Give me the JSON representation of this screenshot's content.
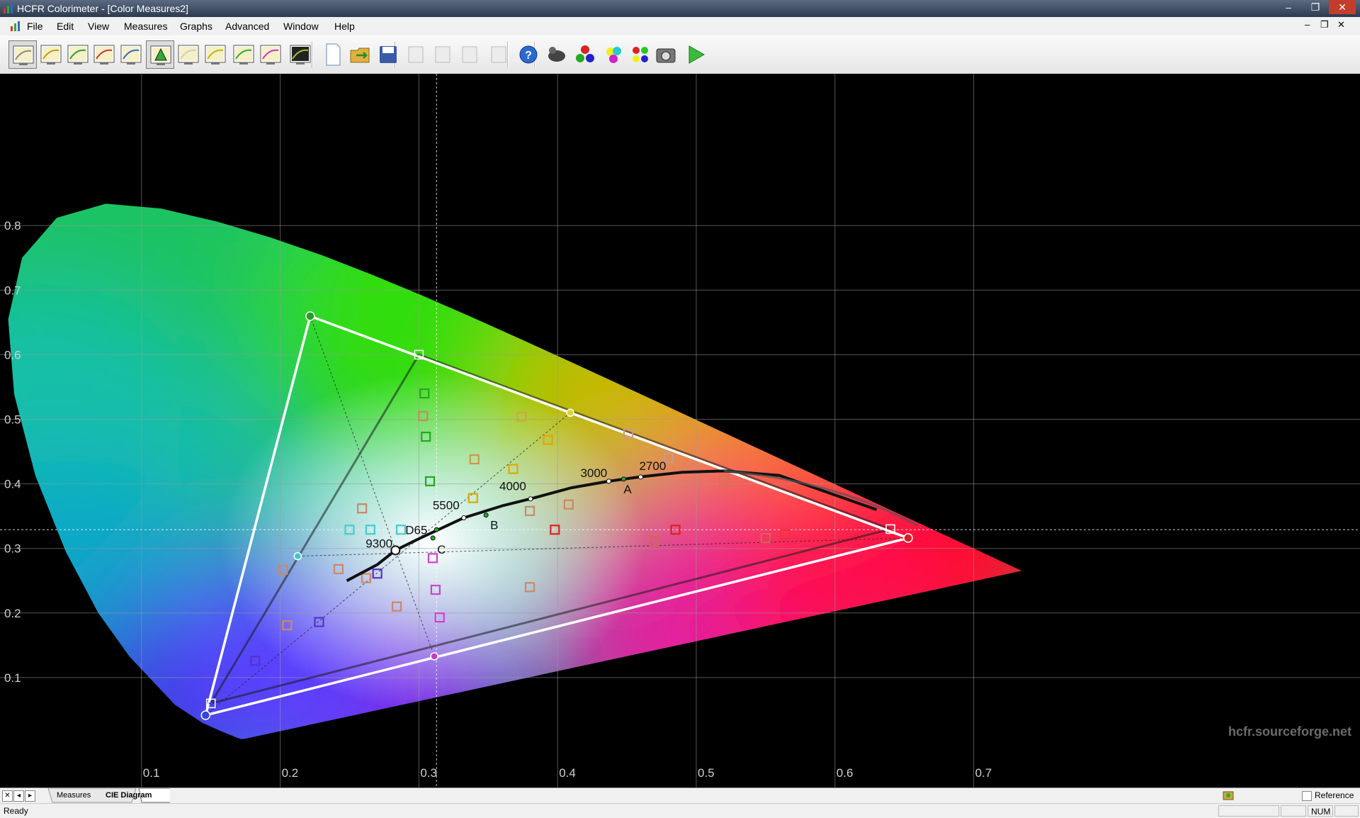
{
  "window": {
    "title": "HCFR Colorimeter - [Color Measures2]",
    "minimize": "–",
    "restore": "❐",
    "close": "✕"
  },
  "menu": [
    "File",
    "Edit",
    "View",
    "Measures",
    "Graphs",
    "Advanced",
    "Window",
    "Help"
  ],
  "mdi_controls": [
    "–",
    "❐",
    "✕"
  ],
  "toolbar": {
    "buttons": [
      "luminance-graph-icon",
      "gamma-graph-icon",
      "gamma-graph-icon-2",
      "rgb-levels-icon",
      "colortemp-graph-icon",
      "cie-diagram-icon",
      "near-black-icon",
      "near-white-icon",
      "saturation-luminance-icon",
      "saturation-shift-icon",
      "measures-icon",
      "new-document-icon",
      "open-folder-icon",
      "save-icon",
      "cut-icon",
      "copy-icon",
      "paste-icon",
      "print-icon",
      "help-icon",
      "sensor-icon",
      "primaries-icon",
      "secondaries-icon",
      "all-colors-icon",
      "camera-icon",
      "play-icon"
    ]
  },
  "chart_data": {
    "type": "scatter",
    "title": "",
    "xlabel": "",
    "ylabel": "",
    "xlim": [
      0.0,
      0.8
    ],
    "ylim": [
      0.0,
      0.9
    ],
    "x_ticks": [
      "0.1",
      "0.2",
      "0.3",
      "0.4",
      "0.5",
      "0.6",
      "0.7"
    ],
    "y_ticks": [
      "0.1",
      "0.2",
      "0.3",
      "0.4",
      "0.5",
      "0.6",
      "0.7",
      "0.8"
    ],
    "grid": true,
    "watermark": "hcfr.sourceforge.net",
    "reference_gamut": [
      [
        0.64,
        0.33
      ],
      [
        0.3,
        0.6
      ],
      [
        0.15,
        0.06
      ]
    ],
    "measured_gamut": [
      [
        0.6527,
        0.3161
      ],
      [
        0.2216,
        0.6597
      ],
      [
        0.1462,
        0.0417
      ]
    ],
    "measured_secondaries": [
      [
        0.4091,
        0.5101
      ],
      [
        0.2126,
        0.288
      ],
      [
        0.3111,
        0.1329
      ]
    ],
    "crosshair": {
      "x": 0.3127,
      "y": 0.329
    },
    "planckian_locus": [
      [
        0.248,
        0.25
      ],
      [
        0.27,
        0.275
      ],
      [
        0.2831,
        0.2971
      ],
      [
        0.3,
        0.315
      ],
      [
        0.3324,
        0.3474
      ],
      [
        0.36,
        0.366
      ],
      [
        0.3805,
        0.3768
      ],
      [
        0.41,
        0.394
      ],
      [
        0.4369,
        0.4041
      ],
      [
        0.46,
        0.411
      ],
      [
        0.49,
        0.418
      ],
      [
        0.52,
        0.42
      ],
      [
        0.56,
        0.413
      ],
      [
        0.63,
        0.36
      ]
    ],
    "locus_labels": [
      {
        "text": "9300",
        "x": 0.2831,
        "y": 0.2971
      },
      {
        "text": "5500",
        "x": 0.3324,
        "y": 0.3474
      },
      {
        "text": "4000",
        "x": 0.3805,
        "y": 0.3768
      },
      {
        "text": "3000",
        "x": 0.4369,
        "y": 0.4041
      },
      {
        "text": "2700",
        "x": 0.4599,
        "y": 0.4106
      }
    ],
    "illuminant_labels": [
      {
        "text": "D65",
        "x": 0.3127,
        "y": 0.329
      },
      {
        "text": "C",
        "x": 0.3101,
        "y": 0.3162
      },
      {
        "text": "B",
        "x": 0.3484,
        "y": 0.3516
      },
      {
        "text": "A",
        "x": 0.4476,
        "y": 0.4074
      }
    ],
    "saturation_points": [
      {
        "x": 0.304,
        "y": 0.54,
        "color": "#22aa22"
      },
      {
        "x": 0.303,
        "y": 0.505,
        "color": "#cc8866"
      },
      {
        "x": 0.305,
        "y": 0.473,
        "color": "#22aa22"
      },
      {
        "x": 0.308,
        "y": 0.404,
        "color": "#22aa22"
      },
      {
        "x": 0.374,
        "y": 0.504,
        "color": "#ccaa44"
      },
      {
        "x": 0.393,
        "y": 0.468,
        "color": "#ddaa00"
      },
      {
        "x": 0.34,
        "y": 0.438,
        "color": "#cc9944"
      },
      {
        "x": 0.368,
        "y": 0.423,
        "color": "#ddaa00"
      },
      {
        "x": 0.339,
        "y": 0.378,
        "color": "#ddaa00"
      },
      {
        "x": 0.451,
        "y": 0.478,
        "color": "#cc9988"
      },
      {
        "x": 0.48,
        "y": 0.44,
        "color": "#cc9988"
      },
      {
        "x": 0.52,
        "y": 0.406,
        "color": "#cc7755"
      },
      {
        "x": 0.408,
        "y": 0.368,
        "color": "#cc8866"
      },
      {
        "x": 0.38,
        "y": 0.358,
        "color": "#cc8866"
      },
      {
        "x": 0.398,
        "y": 0.329,
        "color": "#dd2222"
      },
      {
        "x": 0.485,
        "y": 0.329,
        "color": "#dd2222"
      },
      {
        "x": 0.564,
        "y": 0.322,
        "color": "#ee3333"
      },
      {
        "x": 0.55,
        "y": 0.316,
        "color": "#cc6655"
      },
      {
        "x": 0.47,
        "y": 0.311,
        "color": "#cc6655"
      },
      {
        "x": 0.25,
        "y": 0.329,
        "color": "#44cccc"
      },
      {
        "x": 0.265,
        "y": 0.329,
        "color": "#44cccc"
      },
      {
        "x": 0.287,
        "y": 0.329,
        "color": "#44cccc"
      },
      {
        "x": 0.259,
        "y": 0.362,
        "color": "#cc8866"
      },
      {
        "x": 0.242,
        "y": 0.268,
        "color": "#cc8866"
      },
      {
        "x": 0.262,
        "y": 0.254,
        "color": "#cc8866"
      },
      {
        "x": 0.27,
        "y": 0.261,
        "color": "#5533cc"
      },
      {
        "x": 0.202,
        "y": 0.267,
        "color": "#cc8866"
      },
      {
        "x": 0.205,
        "y": 0.181,
        "color": "#cc8866"
      },
      {
        "x": 0.228,
        "y": 0.186,
        "color": "#5533cc"
      },
      {
        "x": 0.182,
        "y": 0.126,
        "color": "#5533cc"
      },
      {
        "x": 0.284,
        "y": 0.21,
        "color": "#cc8866"
      },
      {
        "x": 0.31,
        "y": 0.285,
        "color": "#cc44cc"
      },
      {
        "x": 0.312,
        "y": 0.236,
        "color": "#cc44cc"
      },
      {
        "x": 0.315,
        "y": 0.193,
        "color": "#cc44cc"
      },
      {
        "x": 0.38,
        "y": 0.24,
        "color": "#cc8866"
      }
    ]
  },
  "tabs": {
    "active": "CIE Diagram",
    "items": [
      "Measures",
      "CIE Diagram"
    ]
  },
  "reference_checkbox": "Reference",
  "status": {
    "text": "Ready",
    "num": "NUM"
  }
}
